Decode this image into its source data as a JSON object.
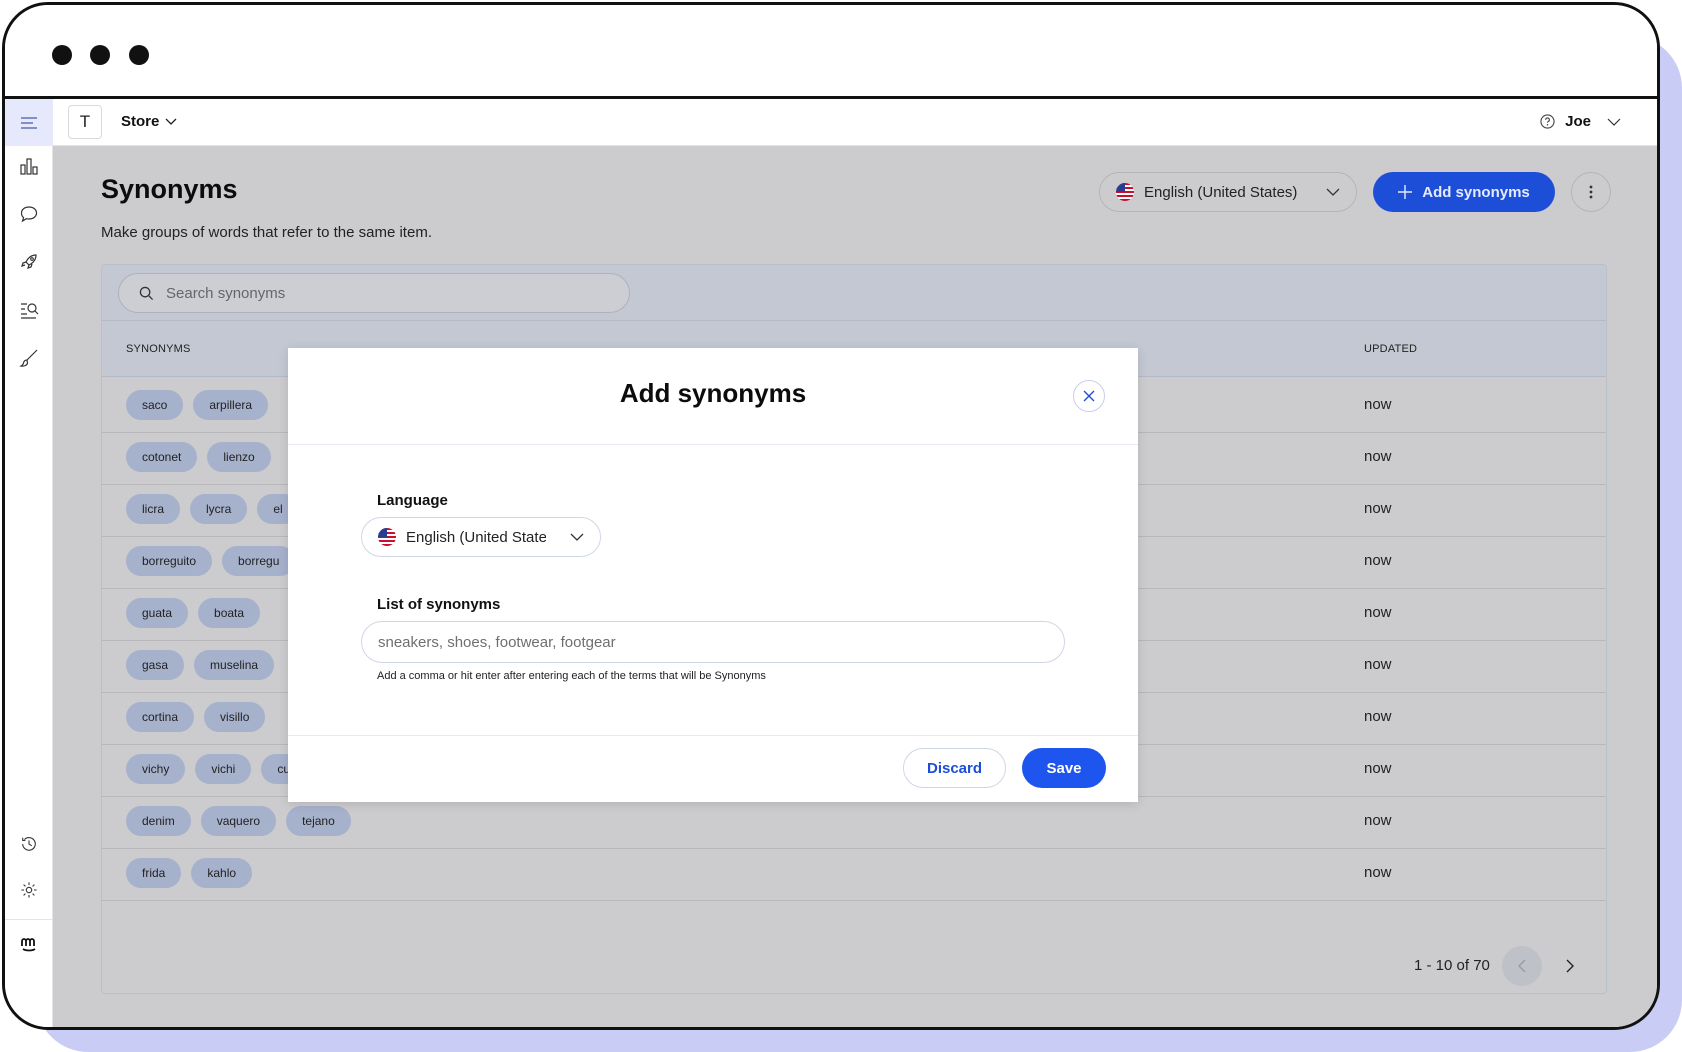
{
  "colors": {
    "accent": "#1d4ed8",
    "overlay_bg": "#ccccce",
    "chip_bg": "#a6b1cc",
    "window_shadow": "#c9ccf5"
  },
  "topnav": {
    "store_initial": "T",
    "store_name": "Store",
    "user_name": "Joe"
  },
  "sidebar": {
    "icons": [
      "analytics-icon",
      "chat-icon",
      "rocket-icon",
      "search-list-icon",
      "brush-icon",
      "history-icon",
      "gear-icon",
      "brand-logo-icon"
    ]
  },
  "page": {
    "title": "Synonyms",
    "subtitle": "Make groups of words that refer to the same item.",
    "language": "English (United States)",
    "add_button": "Add synonyms"
  },
  "table": {
    "search_placeholder": "Search synonyms",
    "col_synonyms": "SYNONYMS",
    "col_updated": "UPDATED",
    "rows": [
      {
        "chips": [
          "saco",
          "arpillera"
        ],
        "updated": "now"
      },
      {
        "chips": [
          "cotonet",
          "lienzo"
        ],
        "updated": "now"
      },
      {
        "chips": [
          "licra",
          "lycra",
          "el"
        ],
        "updated": "now"
      },
      {
        "chips": [
          "borreguito",
          "borregu"
        ],
        "updated": "now"
      },
      {
        "chips": [
          "guata",
          "boata"
        ],
        "updated": "now"
      },
      {
        "chips": [
          "gasa",
          "muselina"
        ],
        "updated": "now"
      },
      {
        "chips": [
          "cortina",
          "visillo"
        ],
        "updated": "now"
      },
      {
        "chips": [
          "vichy",
          "vichi",
          "cu"
        ],
        "updated": "now"
      },
      {
        "chips": [
          "denim",
          "vaquero",
          "tejano"
        ],
        "updated": "now"
      },
      {
        "chips": [
          "frida",
          "kahlo"
        ],
        "updated": "now"
      }
    ],
    "pagination": "1 - 10 of 70"
  },
  "modal": {
    "title": "Add synonyms",
    "language_label": "Language",
    "language_value": "English (United State",
    "list_label": "List of synonyms",
    "list_placeholder": "sneakers, shoes, footwear, footgear",
    "help_text": "Add a comma or hit enter after entering each of the terms that will be Synonyms",
    "discard": "Discard",
    "save": "Save"
  }
}
